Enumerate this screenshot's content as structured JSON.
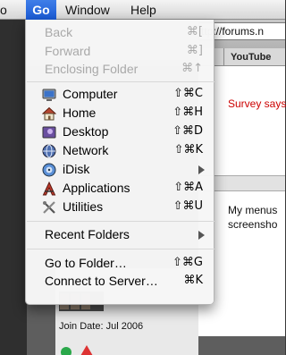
{
  "menubar": {
    "items": [
      {
        "label": "o"
      },
      {
        "label": "Go"
      },
      {
        "label": "Window"
      },
      {
        "label": "Help"
      }
    ]
  },
  "browser": {
    "url": "ttp://forums.n",
    "tab_label": "YouTube",
    "survey_text": "Survey says",
    "post_text_line1": "My menus",
    "post_text_line2": "screensho",
    "join_date": "Join Date: Jul 2006"
  },
  "go_menu": {
    "back": {
      "label": "Back",
      "shortcut": "⌘["
    },
    "forward": {
      "label": "Forward",
      "shortcut": "⌘]"
    },
    "enclosing": {
      "label": "Enclosing Folder",
      "shortcut": "⌘↑"
    },
    "computer": {
      "label": "Computer",
      "shortcut": "⇧⌘C",
      "icon": "computer-icon"
    },
    "home": {
      "label": "Home",
      "shortcut": "⇧⌘H",
      "icon": "home-icon"
    },
    "desktop": {
      "label": "Desktop",
      "shortcut": "⇧⌘D",
      "icon": "desktop-icon"
    },
    "network": {
      "label": "Network",
      "shortcut": "⇧⌘K",
      "icon": "network-icon"
    },
    "idisk": {
      "label": "iDisk",
      "icon": "idisk-icon"
    },
    "applications": {
      "label": "Applications",
      "shortcut": "⇧⌘A",
      "icon": "applications-icon"
    },
    "utilities": {
      "label": "Utilities",
      "shortcut": "⇧⌘U",
      "icon": "utilities-icon"
    },
    "recent": {
      "label": "Recent Folders"
    },
    "goto": {
      "label": "Go to Folder…",
      "shortcut": "⇧⌘G"
    },
    "connect": {
      "label": "Connect to Server…",
      "shortcut": "⌘K"
    }
  },
  "colors": {
    "menubar_active": "#1a5ad4",
    "disabled_text": "#a9a9a9",
    "survey_red": "#cc0000"
  }
}
